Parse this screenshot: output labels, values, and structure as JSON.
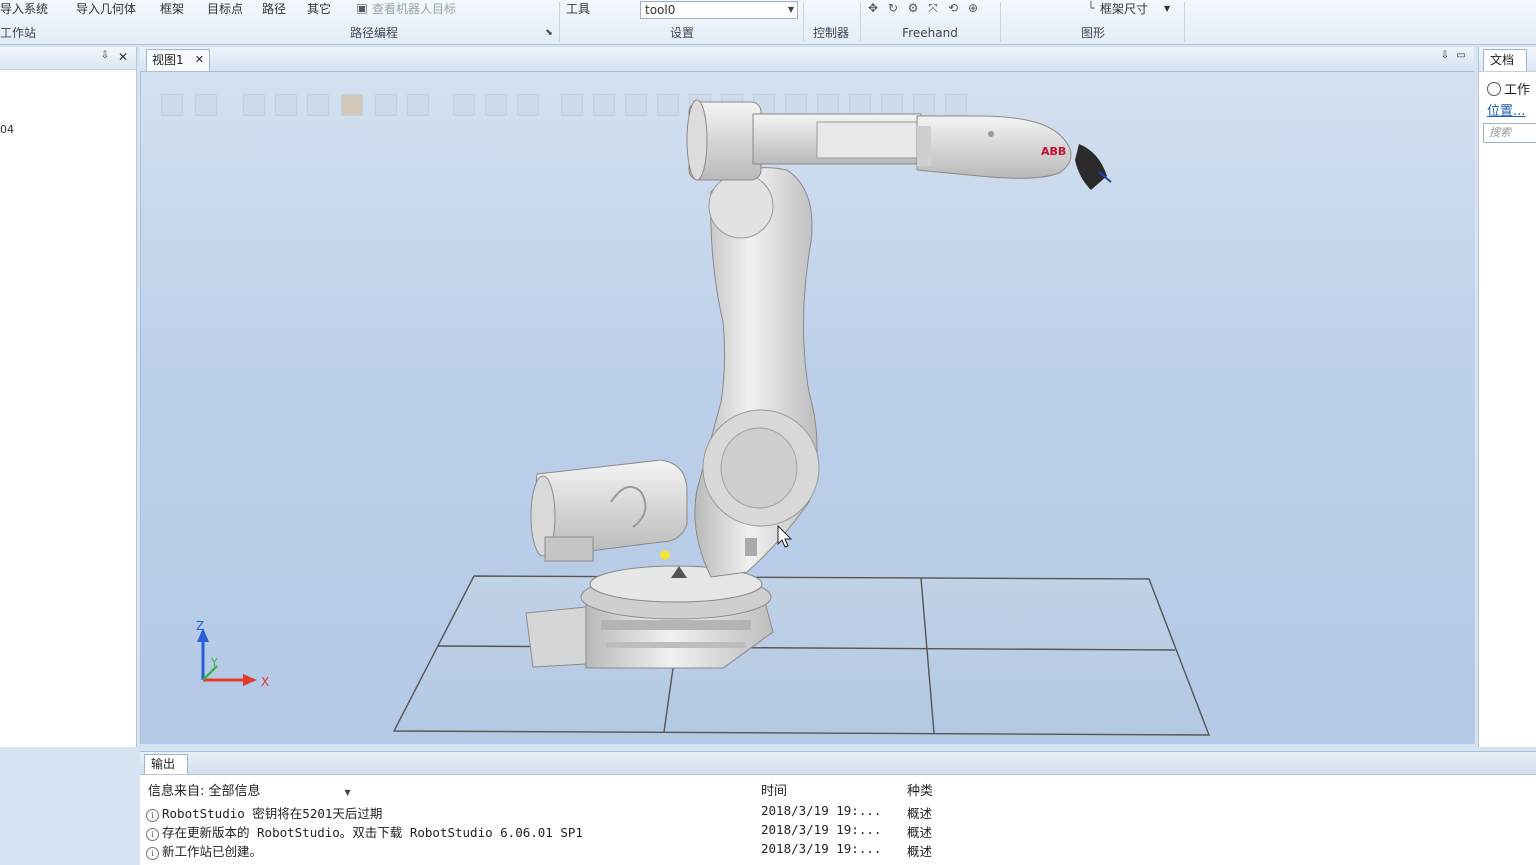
{
  "ribbon": {
    "top_items": [
      "导入系统",
      "导入几何体",
      "框架",
      "目标点",
      "路径",
      "其它",
      "查看机器人目标"
    ],
    "groups": {
      "station": "工作站",
      "path_programming": "路径编程",
      "settings": "设置",
      "controller": "控制器",
      "freehand": "Freehand",
      "graphics": "图形"
    },
    "tool_label": "工具",
    "tool_value": "tool0",
    "frame_size_label": "框架尺寸"
  },
  "left_panel": {
    "item_text": "04"
  },
  "document": {
    "tab_label": "视图1"
  },
  "axes": {
    "x": "X",
    "y": "Y",
    "z": "Z"
  },
  "right_panel": {
    "tab_label": "文档",
    "radio_label": "工作",
    "link_label": "位置...",
    "search_placeholder": "搜索"
  },
  "output": {
    "tab_label": "输出",
    "filter_label": "信息来自: 全部信息",
    "columns": {
      "time": "时间",
      "category": "种类"
    },
    "messages": [
      {
        "text": "RobotStudio 密钥将在5201天后过期",
        "time": "2018/3/19 19:...",
        "category": "概述"
      },
      {
        "text": "存在更新版本的 RobotStudio。双击下载 RobotStudio 6.06.01 SP1",
        "time": "2018/3/19 19:...",
        "category": "概述"
      },
      {
        "text": "新工作站已创建。",
        "time": "2018/3/19 19:...",
        "category": "概述"
      }
    ]
  },
  "colors": {
    "ribbon_bg": "#eaf1f9",
    "viewport_top": "#d3e0f0",
    "viewport_bottom": "#b3c9e6",
    "robot_body": "#dcdcdc",
    "axis_x": "#e23b2a",
    "axis_y": "#3bb34a",
    "axis_z": "#2a5fd6",
    "brand_red": "#c8102e"
  }
}
